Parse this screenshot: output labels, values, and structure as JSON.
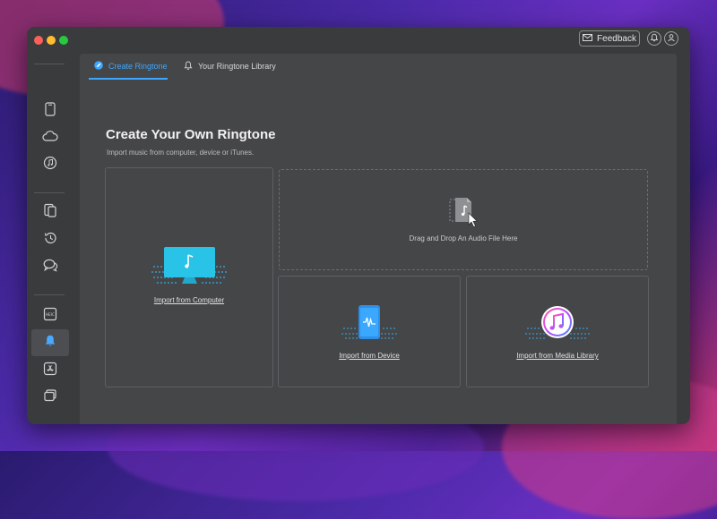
{
  "window": {
    "feedback_label": "Feedback"
  },
  "tabs": [
    {
      "label": "Create Ringtone",
      "active": true
    },
    {
      "label": "Your Ringtone Library",
      "active": false
    }
  ],
  "main": {
    "title": "Create Your Own Ringtone",
    "subtitle": "Import music from computer, device or iTunes."
  },
  "cards": {
    "computer": {
      "label": "Import from Computer",
      "icon": "monitor-music-icon"
    },
    "drop": {
      "label": "Drag and Drop An Audio File Here",
      "icon": "audio-file-drag-icon"
    },
    "device": {
      "label": "Import from Device",
      "icon": "phone-waveform-icon"
    },
    "media_library": {
      "label": "Import from Media Library",
      "icon": "itunes-icon"
    }
  },
  "sidebar": {
    "items": [
      {
        "icon": "device-icon"
      },
      {
        "icon": "cloud-icon"
      },
      {
        "icon": "music-icon"
      },
      {
        "icon": "transfer-icon"
      },
      {
        "icon": "history-icon"
      },
      {
        "icon": "messages-icon"
      },
      {
        "icon": "heic-converter-icon"
      },
      {
        "icon": "ringtone-bell-icon",
        "active": true
      },
      {
        "icon": "app-store-icon"
      },
      {
        "icon": "layers-icon"
      }
    ]
  },
  "colors": {
    "accent": "#3da7ff",
    "window_bg": "#3a3b3d",
    "content_bg": "#454648"
  }
}
